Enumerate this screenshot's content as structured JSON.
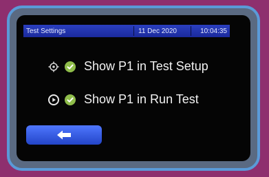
{
  "status_bar": {
    "title": "Test Settings",
    "date": "11 Dec 2020",
    "time": "10:04:35"
  },
  "options": [
    {
      "icon": "gear-target-icon",
      "checked": true,
      "label": "Show P1 in Test Setup"
    },
    {
      "icon": "play-circle-icon",
      "checked": true,
      "label": "Show P1 in Run Test"
    }
  ],
  "back_button": {
    "icon": "arrow-left-icon"
  },
  "colors": {
    "bezel": "#5a9ad8",
    "status_bar": "#1b2a9c",
    "check": "#8fbd4a",
    "button": "#2f55e0"
  }
}
